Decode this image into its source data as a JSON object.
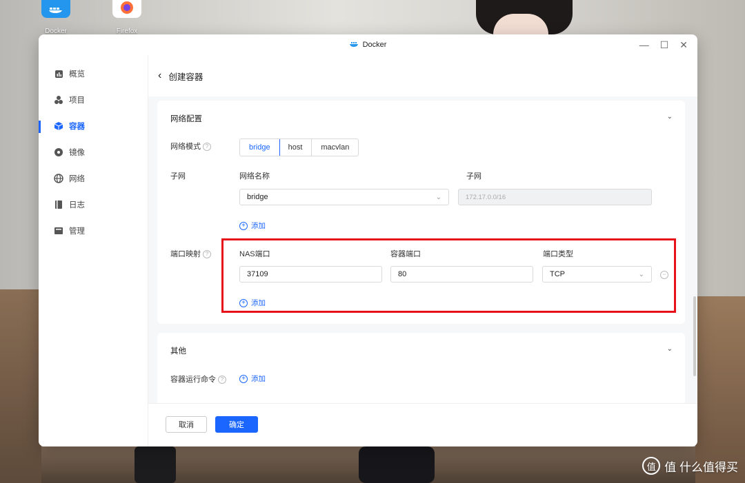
{
  "desktop": {
    "icons": [
      {
        "label": "Docker"
      },
      {
        "label": "Firefox"
      }
    ],
    "watermark": "值 什么值得买"
  },
  "window": {
    "title": "Docker",
    "controls": {
      "minimize": "—",
      "maximize": "☐",
      "close": "✕"
    }
  },
  "sidebar": {
    "items": [
      {
        "label": "概览"
      },
      {
        "label": "项目"
      },
      {
        "label": "容器"
      },
      {
        "label": "镜像"
      },
      {
        "label": "网络"
      },
      {
        "label": "日志"
      },
      {
        "label": "管理"
      }
    ],
    "active": "容器"
  },
  "page": {
    "back": "‹",
    "title": "创建容器"
  },
  "network": {
    "section_title": "网络配置",
    "mode_label": "网络模式",
    "modes": [
      "bridge",
      "host",
      "macvlan"
    ],
    "selected_mode": "bridge",
    "subnet_label": "子网",
    "col_network_name": "网络名称",
    "col_subnet": "子网",
    "network_name_value": "bridge",
    "subnet_value": "172.17.0.0/16",
    "add_label": "添加"
  },
  "ports": {
    "label": "端口映射",
    "col_nas": "NAS端口",
    "col_container": "容器端口",
    "col_type": "端口类型",
    "nas_value": "37109",
    "container_value": "80",
    "type_value": "TCP",
    "add_label": "添加"
  },
  "other": {
    "section_title": "其他",
    "cmd_label": "容器运行命令",
    "add_label": "添加"
  },
  "footer": {
    "cancel": "取消",
    "confirm": "确定"
  },
  "colors": {
    "accent": "#1a66ff",
    "highlight": "#e8111a"
  }
}
